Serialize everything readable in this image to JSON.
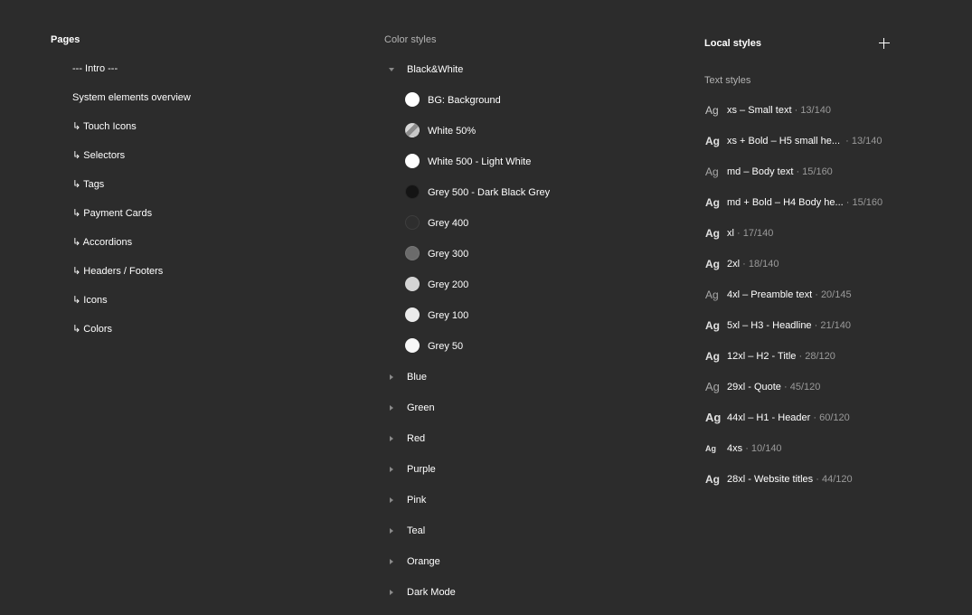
{
  "pages": {
    "title": "Pages",
    "items": [
      {
        "label": "--- Intro ---"
      },
      {
        "label": "System elements overview"
      },
      {
        "label": "↳ Touch Icons"
      },
      {
        "label": "↳ Selectors"
      },
      {
        "label": "↳ Tags"
      },
      {
        "label": "↳ Payment Cards"
      },
      {
        "label": "↳ Accordions"
      },
      {
        "label": "↳ Headers / Footers"
      },
      {
        "label": "↳ Icons"
      },
      {
        "label": "↳ Colors"
      }
    ]
  },
  "color_styles": {
    "title": "Color styles",
    "expanded_group": {
      "label": "Black&White",
      "swatches": [
        {
          "label": "BG: Background",
          "color": "#ffffff"
        },
        {
          "label": "White 50%",
          "color": "half-transparent"
        },
        {
          "label": "White 500 - Light White",
          "color": "#ffffff"
        },
        {
          "label": "Grey 500 - Dark Black Grey",
          "color": "#141414"
        },
        {
          "label": "Grey 400",
          "color": "#2e2e2e"
        },
        {
          "label": "Grey 300",
          "color": "#6b6b6b"
        },
        {
          "label": "Grey 200",
          "color": "#d4d4d4"
        },
        {
          "label": "Grey 100",
          "color": "#ebebeb"
        },
        {
          "label": "Grey 50",
          "color": "#f7f7f7"
        }
      ]
    },
    "collapsed_groups": [
      {
        "label": "Blue"
      },
      {
        "label": "Green"
      },
      {
        "label": "Red"
      },
      {
        "label": "Purple"
      },
      {
        "label": "Pink"
      },
      {
        "label": "Teal"
      },
      {
        "label": "Orange"
      },
      {
        "label": "Dark Mode"
      }
    ]
  },
  "local_styles": {
    "title": "Local styles",
    "add_icon": "plus-icon",
    "text_styles_title": "Text styles",
    "text_styles": [
      {
        "preview": "Ag",
        "weight": "normal",
        "name": "xs – Small text",
        "meta": "· 13/140"
      },
      {
        "preview": "Ag",
        "weight": "bold",
        "name": "xs + Bold – H5 small he...",
        "meta": "· 13/140"
      },
      {
        "preview": "Ag",
        "weight": "light",
        "name": "md – Body text",
        "meta": "· 15/160"
      },
      {
        "preview": "Ag",
        "weight": "bold",
        "name": "md + Bold – H4 Body he...",
        "meta": "· 15/160"
      },
      {
        "preview": "Ag",
        "weight": "bold",
        "name": "xl",
        "meta": "· 17/140"
      },
      {
        "preview": "Ag",
        "weight": "bold",
        "name": "2xl",
        "meta": "· 18/140"
      },
      {
        "preview": "Ag",
        "weight": "light",
        "name": "4xl – Preamble text",
        "meta": "· 20/145"
      },
      {
        "preview": "Ag",
        "weight": "bold",
        "name": "5xl – H3 - Headline",
        "meta": "· 21/140"
      },
      {
        "preview": "Ag",
        "weight": "bold",
        "name": "12xl – H2 - Title",
        "meta": "· 28/120"
      },
      {
        "preview": "Ag",
        "weight": "light-large",
        "name": "29xl - Quote",
        "meta": "· 45/120"
      },
      {
        "preview": "Ag",
        "weight": "bold",
        "name": "44xl – H1 - Header",
        "meta": "· 60/120"
      },
      {
        "preview": "Ag",
        "weight": "bold-small",
        "name": "4xs",
        "meta": "· 10/140"
      },
      {
        "preview": "Ag",
        "weight": "bold",
        "name": "28xl - Website titles",
        "meta": "· 44/120"
      }
    ]
  }
}
